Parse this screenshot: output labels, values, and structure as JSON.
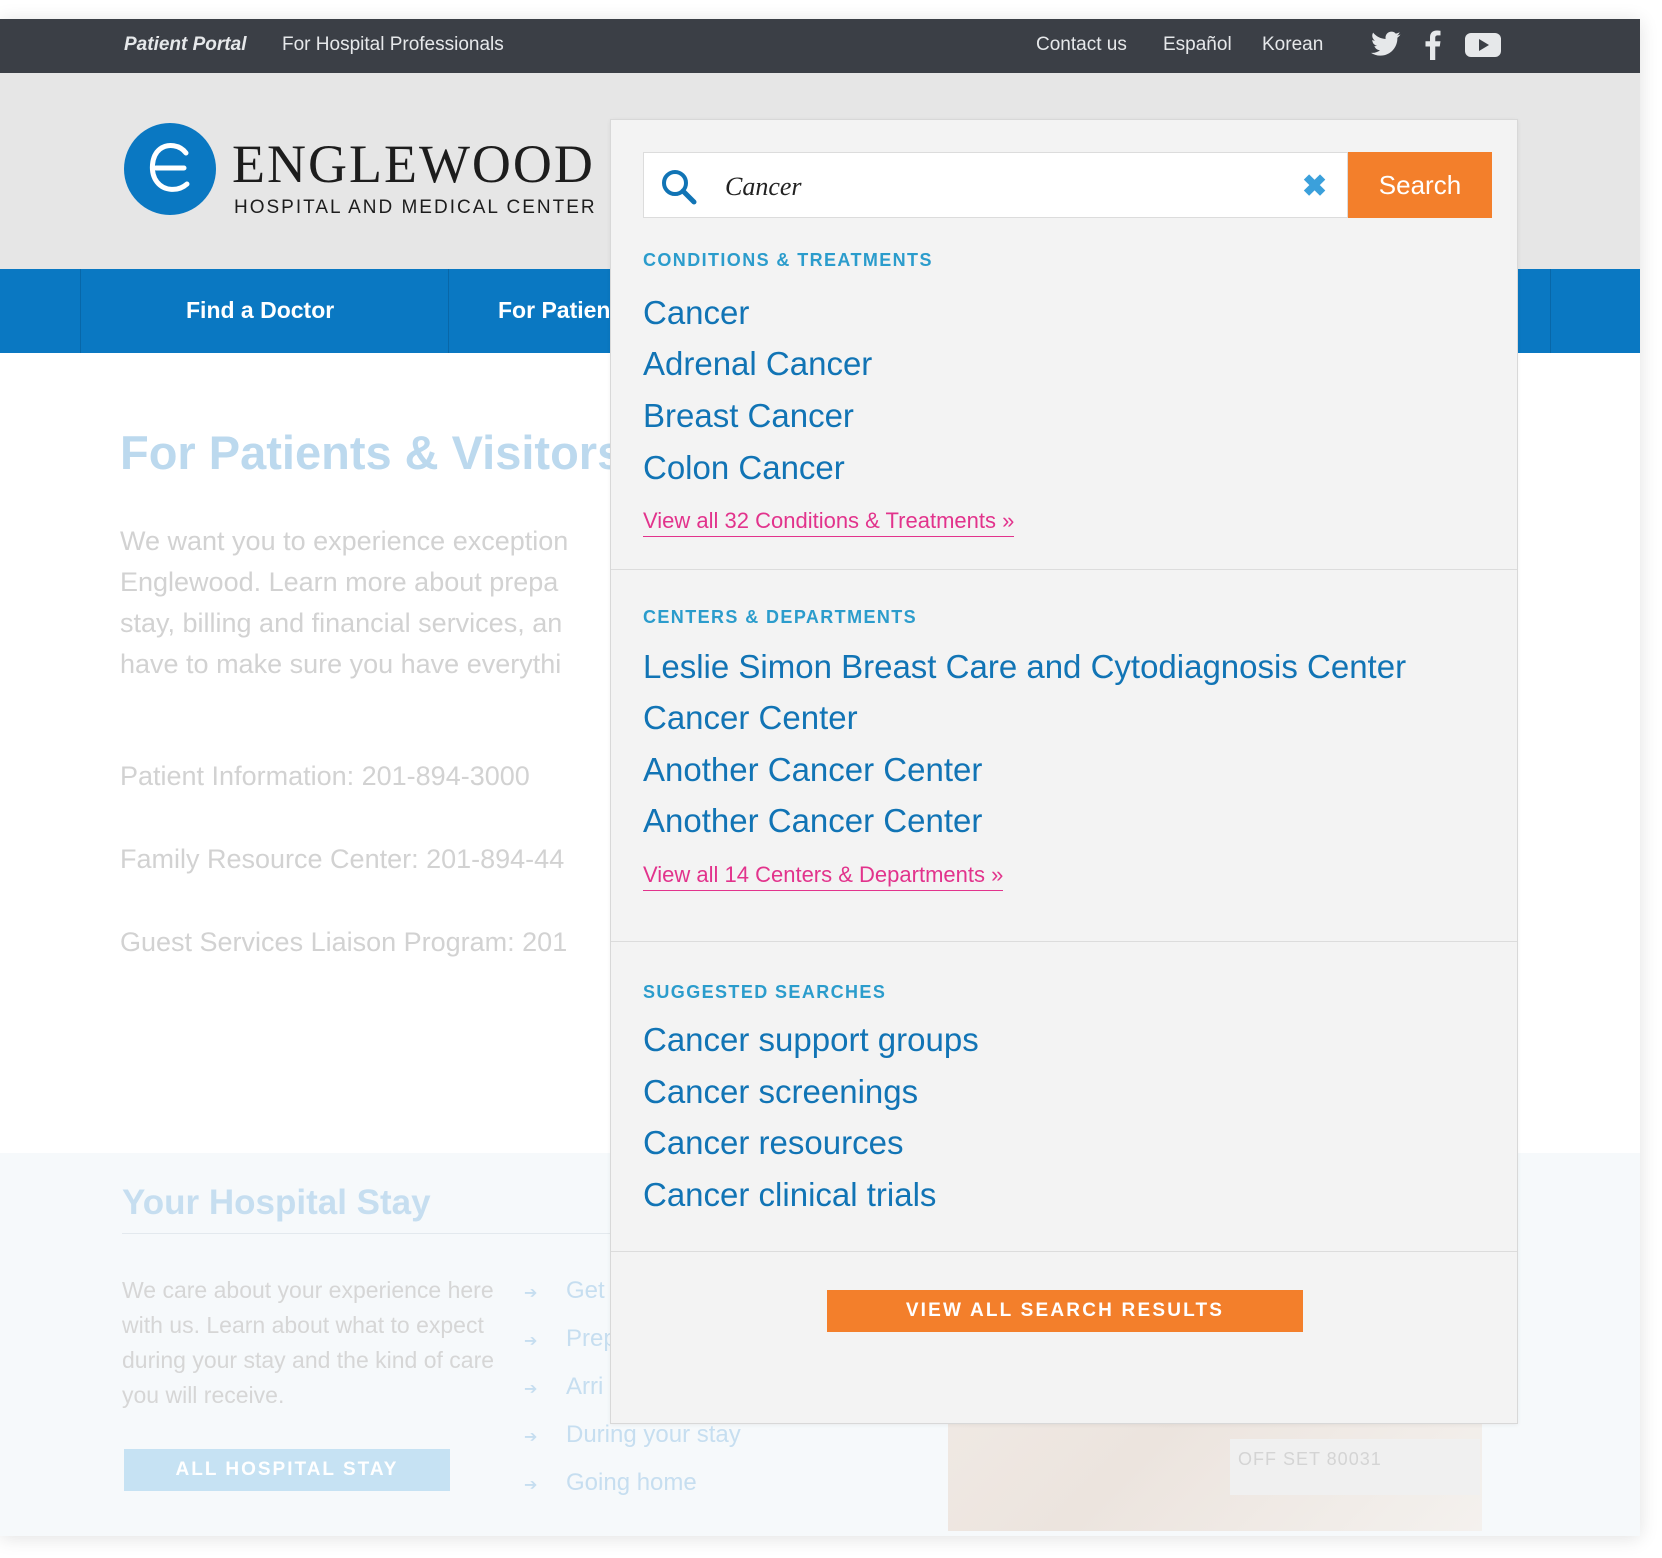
{
  "topbar": {
    "patient_portal": "Patient Portal",
    "hospital_professionals": "For Hospital Professionals",
    "contact": "Contact us",
    "espanol": "Español",
    "korean": "Korean",
    "social": [
      "twitter-icon",
      "facebook-icon",
      "youtube-icon"
    ]
  },
  "header": {
    "logo_name": "ENGLEWOOD",
    "logo_sub": "HOSPITAL AND MEDICAL CENTER"
  },
  "nav": {
    "items": [
      {
        "label": "Find a Doctor"
      },
      {
        "label": "For Patients"
      }
    ]
  },
  "page": {
    "title": "For Patients & Visitors",
    "intro_lines": [
      "We want you to experience exception",
      "Englewood. Learn more about prepa",
      "stay, billing and financial services, an",
      "have to make sure you have everythi"
    ],
    "info": [
      "Patient Information: 201-894-3000",
      "Family Resource Center: 201-894-44",
      "Guest Services Liaison Program: 201"
    ]
  },
  "stay": {
    "title": "Your Hospital Stay",
    "text": "We care about your experience here with us. Learn about what to expect during your stay and the kind of care you will receive.",
    "button": "ALL HOSPITAL STAY",
    "links": [
      "Get",
      "Prep",
      "Arri",
      "During your stay",
      "Going home"
    ],
    "photo_tag": "OFF SET   80031"
  },
  "search": {
    "query": "Cancer",
    "button": "Search",
    "conditions": {
      "heading": "CONDITIONS & TREATMENTS",
      "items": [
        "Cancer",
        "Adrenal Cancer",
        "Breast Cancer",
        "Colon Cancer"
      ],
      "view_all": "View all 32 Conditions & Treatments »"
    },
    "centers": {
      "heading": "CENTERS & DEPARTMENTS",
      "items": [
        "Leslie Simon Breast Care and Cytodiagnosis Center",
        "Cancer Center",
        "Another Cancer Center",
        "Another Cancer Center"
      ],
      "view_all": "View all 14 Centers & Departments »"
    },
    "suggested": {
      "heading": "SUGGESTED SEARCHES",
      "items": [
        "Cancer support groups",
        "Cancer screenings",
        "Cancer resources",
        "Cancer clinical trials"
      ]
    },
    "view_all_results": "VIEW ALL SEARCH RESULTS"
  },
  "colors": {
    "topbar": "#3b3f46",
    "nav": "#0a78c2",
    "accent_orange": "#f37f2b",
    "link_blue": "#1174b5",
    "heading_teal": "#2b9ccc",
    "view_all_pink": "#e2338c"
  }
}
